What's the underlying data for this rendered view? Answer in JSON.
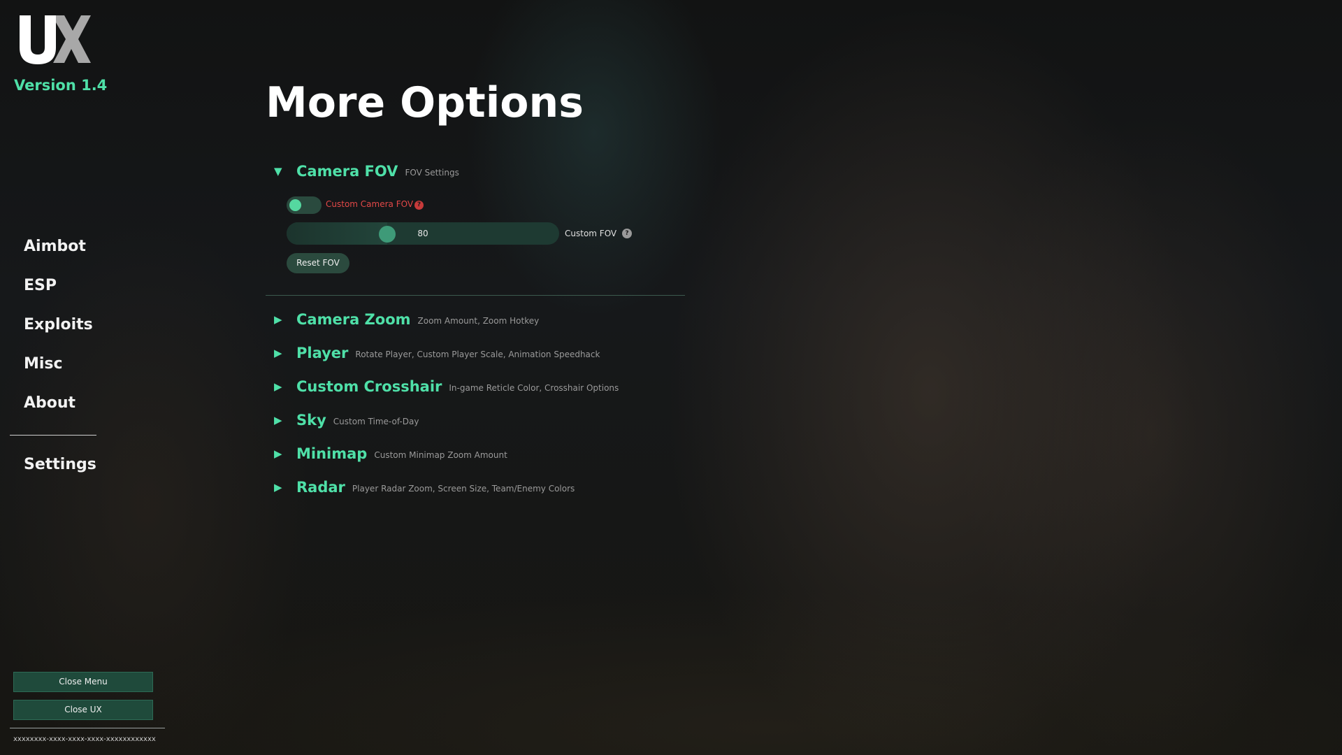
{
  "app": {
    "logo_text": "UX",
    "version": "Version 1.4",
    "accent_color": "#4fe0a8"
  },
  "sidebar": {
    "items": [
      {
        "label": "Aimbot"
      },
      {
        "label": "ESP"
      },
      {
        "label": "Exploits"
      },
      {
        "label": "Misc"
      },
      {
        "label": "About"
      }
    ],
    "settings_label": "Settings",
    "close_menu_label": "Close Menu",
    "close_ux_label": "Close UX",
    "license_id": "xxxxxxxx-xxxx-xxxx-xxxx-xxxxxxxxxxxx"
  },
  "main": {
    "title": "More Options",
    "camera_fov": {
      "title": "Camera FOV",
      "description": "FOV Settings",
      "expanded": true,
      "toggle": {
        "label": "Custom Camera FOV",
        "on": true,
        "help_icon": "question-icon"
      },
      "slider": {
        "label": "Custom FOV",
        "value": "80",
        "fraction": 0.37,
        "help_icon": "question-icon"
      },
      "reset_label": "Reset FOV"
    },
    "sections": [
      {
        "title": "Camera Zoom",
        "description": "Zoom Amount, Zoom Hotkey"
      },
      {
        "title": "Player",
        "description": "Rotate Player, Custom Player Scale, Animation Speedhack"
      },
      {
        "title": "Custom Crosshair",
        "description": "In-game Reticle Color, Crosshair Options"
      },
      {
        "title": "Sky",
        "description": "Custom Time-of-Day"
      },
      {
        "title": "Minimap",
        "description": "Custom Minimap Zoom Amount"
      },
      {
        "title": "Radar",
        "description": "Player Radar Zoom, Screen Size, Team/Enemy Colors"
      }
    ]
  }
}
